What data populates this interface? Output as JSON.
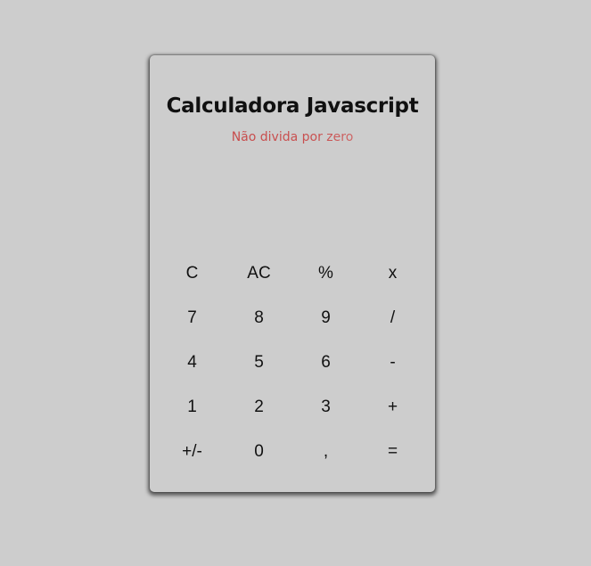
{
  "header": {
    "title": "Calculadora Javascript",
    "subtitle": "Não divida por zero"
  },
  "display": {
    "value": ""
  },
  "keys": [
    {
      "label": "C"
    },
    {
      "label": "AC"
    },
    {
      "label": "%"
    },
    {
      "label": "x"
    },
    {
      "label": "7"
    },
    {
      "label": "8"
    },
    {
      "label": "9"
    },
    {
      "label": "/"
    },
    {
      "label": "4"
    },
    {
      "label": "5"
    },
    {
      "label": "6"
    },
    {
      "label": "-"
    },
    {
      "label": "1"
    },
    {
      "label": "2"
    },
    {
      "label": "3"
    },
    {
      "label": "+"
    },
    {
      "label": "+/-"
    },
    {
      "label": "0"
    },
    {
      "label": ","
    },
    {
      "label": "="
    }
  ],
  "colors": {
    "background": "#cdcdcd",
    "title": "#101010",
    "subtitle": "#c64545"
  }
}
